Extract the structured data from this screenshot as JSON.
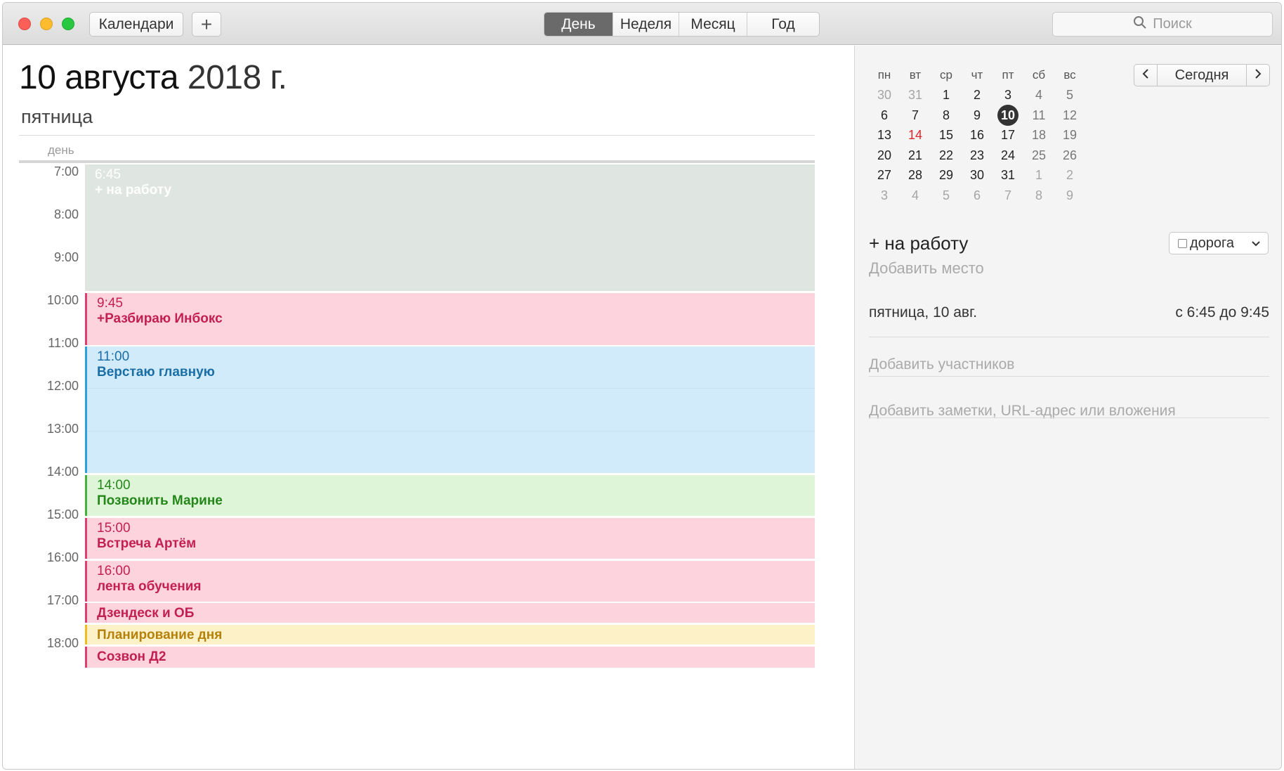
{
  "toolbar": {
    "calendars_label": "Календари",
    "add_label": "+",
    "views": [
      "День",
      "Неделя",
      "Месяц",
      "Год"
    ],
    "active_view": "День",
    "search_placeholder": "Поиск"
  },
  "day": {
    "date": "10 августа",
    "year": "2018 г.",
    "weekday": "пятница",
    "allday_label": "день",
    "hours": [
      "7:00",
      "8:00",
      "9:00",
      "10:00",
      "11:00",
      "12:00",
      "13:00",
      "14:00",
      "15:00",
      "16:00",
      "17:00",
      "18:00"
    ],
    "events": [
      {
        "time": "6:45",
        "name": "+ на работу",
        "color": "grey"
      },
      {
        "time": "9:45",
        "name": "+Разбираю Инбокс",
        "color": "pink"
      },
      {
        "time": "11:00",
        "name": "Верстаю главную",
        "color": "blue"
      },
      {
        "time": "14:00",
        "name": "Позвонить Марине",
        "color": "green"
      },
      {
        "time": "15:00",
        "name": "Встреча Артём",
        "color": "pink"
      },
      {
        "time": "16:00",
        "name": "лента обучения",
        "color": "pink"
      },
      {
        "time": "",
        "name": "Дзендеск  и ОБ",
        "color": "pink"
      },
      {
        "time": "",
        "name": "Планирование дня",
        "color": "yellow"
      },
      {
        "time": "",
        "name": "Созвон Д2",
        "color": "pink"
      }
    ]
  },
  "mini_calendar": {
    "weekdays": [
      "пн",
      "вт",
      "ср",
      "чт",
      "пт",
      "сб",
      "вс"
    ],
    "weeks": [
      [
        "30",
        "31",
        "1",
        "2",
        "3",
        "4",
        "5"
      ],
      [
        "6",
        "7",
        "8",
        "9",
        "10",
        "11",
        "12"
      ],
      [
        "13",
        "14",
        "15",
        "16",
        "17",
        "18",
        "19"
      ],
      [
        "20",
        "21",
        "22",
        "23",
        "24",
        "25",
        "26"
      ],
      [
        "27",
        "28",
        "29",
        "30",
        "31",
        "1",
        "2"
      ],
      [
        "3",
        "4",
        "5",
        "6",
        "7",
        "8",
        "9"
      ]
    ],
    "today_label": "Сегодня",
    "selected_day": "10",
    "highlight_day": "14"
  },
  "inspector": {
    "title": "+ на работу",
    "calendar": "дорога",
    "add_place": "Добавить место",
    "date": "пятница, 10 авг.",
    "time": "с 6:45 до 9:45",
    "add_participants": "Добавить участников",
    "add_notes": "Добавить заметки, URL-адрес или вложения"
  },
  "colors": {
    "pink": "#fdd3de",
    "blue": "#d1ebfa",
    "green": "#dff5d7",
    "yellow": "#fdf1c8",
    "grey": "#dfe6e1",
    "selected_day_bg": "#333333",
    "highlight_day": "#e0262b"
  }
}
